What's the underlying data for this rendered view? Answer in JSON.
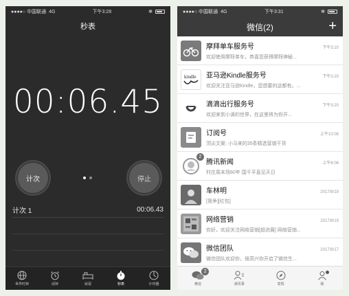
{
  "stopwatch": {
    "status": {
      "carrier": "●●●●○ 中国联通",
      "network": "4G",
      "time": "下午3:28",
      "bluetooth": "✻"
    },
    "title": "秒表",
    "time": "00:06.45",
    "lap_button": "计次",
    "stop_button": "停止",
    "laps": [
      {
        "label": "计次 1",
        "time": "00:06.43"
      }
    ],
    "tabs": [
      {
        "label": "世界时钟",
        "icon": "globe-icon"
      },
      {
        "label": "闹钟",
        "icon": "alarm-clock-icon"
      },
      {
        "label": "就寝",
        "icon": "bed-icon"
      },
      {
        "label": "秒表",
        "icon": "stopwatch-icon",
        "active": true
      },
      {
        "label": "计时器",
        "icon": "timer-icon"
      }
    ]
  },
  "wechat": {
    "status": {
      "carrier": "●●●●○ 中国联通",
      "network": "4G",
      "time": "下午3:31",
      "bluetooth": "✻"
    },
    "title": "微信(2)",
    "add_label": "+",
    "chats": [
      {
        "name": "摩拜单车服务号",
        "time": "下午3:20",
        "message": "欢迎使用摩拜单车，恭喜您获得摩拜神秘...",
        "avatar": "bike-avatar-icon",
        "avatar_bg": "#7a7a7a"
      },
      {
        "name": "亚马逊Kindle服务号",
        "time": "下午3:20",
        "message": "欢迎关注亚马逊Kindle，您想要的这都有。...",
        "avatar": "kindle-avatar-icon",
        "avatar_bg": "#ffffff"
      },
      {
        "name": "滴滴出行服务号",
        "time": "下午3:20",
        "message": "欢迎来到小滴的世界，在这里将为你开...",
        "avatar": "didi-avatar-icon",
        "avatar_bg": "#ffffff"
      },
      {
        "name": "订阅号",
        "time": "上午10:08",
        "message": "顶尖文案: 小马来的35条精选营销干货",
        "avatar": "subscription-avatar-icon",
        "avatar_bg": "#8a8a8a"
      },
      {
        "name": "腾讯新闻",
        "time": "上午8:06",
        "message": "村庄周末场80年 国千平直见天日",
        "avatar": "tencent-news-avatar-icon",
        "avatar_bg": "#ffffff",
        "badge": "2"
      },
      {
        "name": "车林明",
        "time": "2017/8/19",
        "message": "[我争][红包]",
        "avatar": "person-avatar-icon",
        "avatar_bg": "#6a6a6a"
      },
      {
        "name": "网络营销",
        "time": "2017/8/19",
        "message": "你好，欢迎关注网络营销[超进展] 网络营销...",
        "avatar": "marketing-avatar-icon",
        "avatar_bg": "#9a9a9a"
      },
      {
        "name": "微信团队",
        "time": "2017/8/17",
        "message": "微信团队欢迎你，很高兴你开启了微信生...",
        "avatar": "wechat-team-avatar-icon",
        "avatar_bg": "#777777"
      }
    ],
    "tabs": [
      {
        "label": "微信",
        "icon": "chat-icon",
        "badge": "2"
      },
      {
        "label": "通讯录",
        "icon": "contacts-icon"
      },
      {
        "label": "发现",
        "icon": "compass-icon"
      },
      {
        "label": "我",
        "icon": "me-icon",
        "dot": true
      }
    ]
  }
}
